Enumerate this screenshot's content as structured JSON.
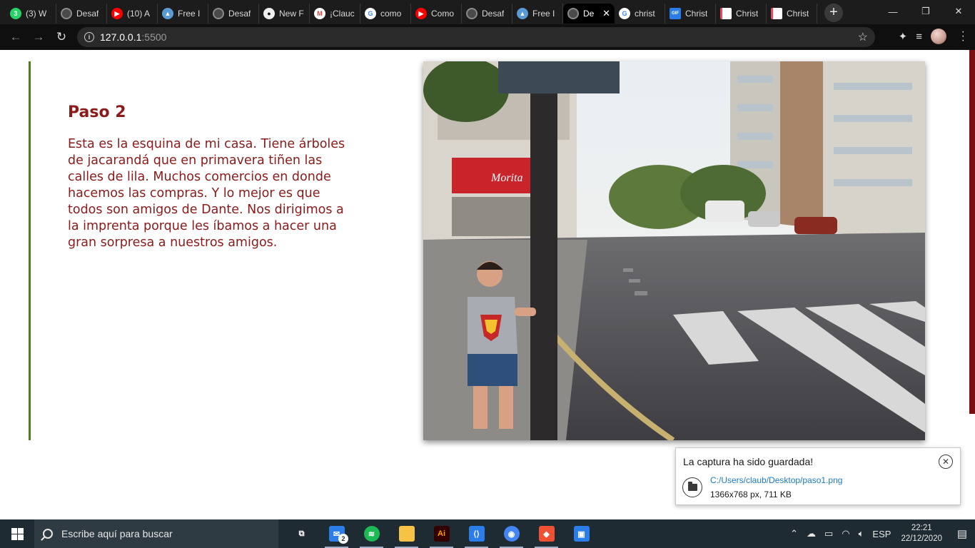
{
  "browser": {
    "tabs": [
      {
        "title": "(3) W",
        "icon": "whatsapp-icon",
        "color": "#25d366",
        "glyph": "3"
      },
      {
        "title": "Desaf",
        "icon": "globe-icon",
        "color": "#6a6a6a",
        "glyph": ""
      },
      {
        "title": "(10) A",
        "icon": "youtube-icon",
        "color": "#ff0000",
        "glyph": "▶"
      },
      {
        "title": "Free I",
        "icon": "shapes-icon",
        "color": "#5b9bd5",
        "glyph": "▲"
      },
      {
        "title": "Desaf",
        "icon": "globe-icon",
        "color": "#6a6a6a",
        "glyph": ""
      },
      {
        "title": "New F",
        "icon": "github-icon",
        "color": "#f0f0f0",
        "glyph": ""
      },
      {
        "title": "¡Clauc",
        "icon": "gmail-icon",
        "color": "#ea4335",
        "glyph": "M"
      },
      {
        "title": "como",
        "icon": "google-icon",
        "color": "#4285f4",
        "glyph": "G"
      },
      {
        "title": "Como",
        "icon": "youtube-icon",
        "color": "#ff0000",
        "glyph": "▶"
      },
      {
        "title": "Desaf",
        "icon": "globe-icon",
        "color": "#6a6a6a",
        "glyph": ""
      },
      {
        "title": "Free I",
        "icon": "shapes-icon",
        "color": "#5b9bd5",
        "glyph": "▲"
      },
      {
        "title": "De",
        "icon": "globe-icon",
        "color": "#6a6a6a",
        "glyph": "",
        "active": true
      },
      {
        "title": "christ",
        "icon": "google-icon",
        "color": "#4285f4",
        "glyph": "G"
      },
      {
        "title": "Christ",
        "icon": "gif-icon",
        "color": "#2b7de9",
        "glyph": "GIF"
      },
      {
        "title": "Christ",
        "icon": "document-icon",
        "color": "#e84a5f",
        "glyph": ""
      },
      {
        "title": "Christ",
        "icon": "document-icon",
        "color": "#e84a5f",
        "glyph": ""
      }
    ],
    "address": {
      "host": "127.0.0.1",
      "port": ":5500"
    }
  },
  "content": {
    "title": "Paso 2",
    "text": "Esta es la esquina de mi casa. Tiene árboles de jacarandá que en primavera tiñen las calles de lila. Muchos comercios en donde hacemos las compras. Y lo mejor es que todos son amigos de Dante. Nos dirigimos a la imprenta porque les íbamos a hacer una gran sorpresa a nuestros amigos.",
    "photo": {
      "store_sign": "Morita"
    }
  },
  "notification": {
    "title": "La captura ha sido guardada!",
    "path": "C:/Users/claub/Desktop/paso1.png",
    "meta": "1366x768 px, 711 KB"
  },
  "taskbar": {
    "search_placeholder": "Escribe aquí para buscar",
    "apps": [
      {
        "name": "task-view-icon",
        "color": "#e6e6e6",
        "glyph": "⧉"
      },
      {
        "name": "mail-icon",
        "color": "#2b7de9",
        "glyph": "✉",
        "badge": "2"
      },
      {
        "name": "spotify-icon",
        "color": "#1db954",
        "glyph": "≋"
      },
      {
        "name": "file-explorer-icon",
        "color": "#f6c344",
        "glyph": ""
      },
      {
        "name": "illustrator-icon",
        "color": "#330000",
        "glyph": "Ai"
      },
      {
        "name": "vscode-icon",
        "color": "#2b7de9",
        "glyph": "⟨⟩"
      },
      {
        "name": "chrome-icon",
        "color": "#4285f4",
        "glyph": "◉"
      },
      {
        "name": "git-icon",
        "color": "#f05033",
        "glyph": "◆"
      },
      {
        "name": "photos-icon",
        "color": "#2b7de9",
        "glyph": "▣"
      }
    ],
    "lang": "ESP",
    "time": "22:21",
    "date": "22/12/2020"
  }
}
